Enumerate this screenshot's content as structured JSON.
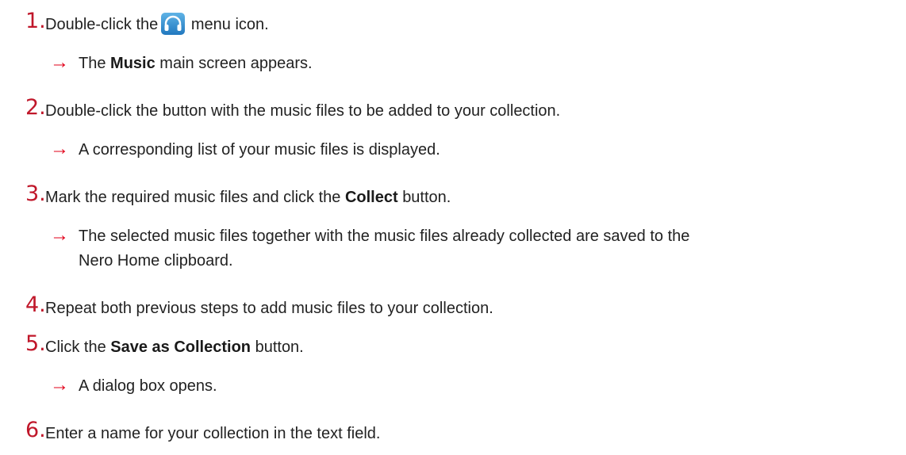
{
  "steps": [
    {
      "num": "1.",
      "pre": "Double-click the",
      "post": "menu icon.",
      "icon": "headphones-icon"
    },
    {
      "num": "2.",
      "text": "Double-click the button with the music files to be added to your collection."
    },
    {
      "num": "3.",
      "pre": "Mark the required music files and click the",
      "bold": "Collect",
      "post": "button."
    },
    {
      "num": "4.",
      "text": "Repeat both previous steps to add music files to your collection."
    },
    {
      "num": "5.",
      "pre": "Click the",
      "bold": "Save as Collection",
      "post": "button."
    },
    {
      "num": "6.",
      "text": "Enter a name for your collection in the text field."
    }
  ],
  "results": [
    {
      "arrow": "→",
      "pre": "The",
      "bold": "Music",
      "post": "main screen appears."
    },
    {
      "arrow": "→",
      "text": "A corresponding list of your music files is displayed."
    },
    {
      "arrow": "→",
      "line1": "The selected music files together with the music files already collected are saved to the",
      "line2": "Nero Home clipboard."
    },
    {
      "arrow": "→",
      "text": "A dialog box opens."
    }
  ],
  "colors": {
    "step_number": "#c0172a",
    "arrow": "#e2001a",
    "icon_bg": "#2b82c9"
  }
}
